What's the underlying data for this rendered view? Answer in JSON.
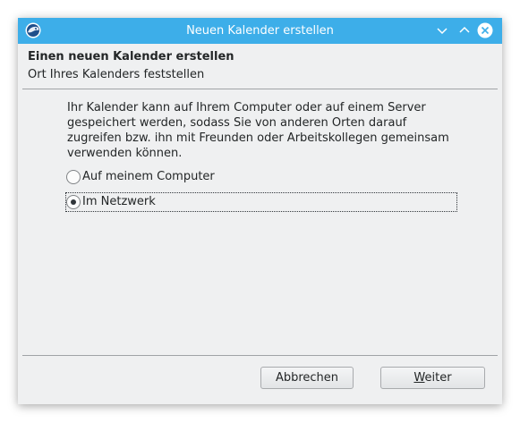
{
  "window": {
    "title": "Neuen Kalender erstellen",
    "app_icon": "thunderbird-icon",
    "accent": "#3daee9",
    "controls": {
      "minimize_icon": "chevron-down-icon",
      "maximize_icon": "chevron-up-icon",
      "close_icon": "close-circle-icon"
    }
  },
  "header": {
    "title": "Einen neuen Kalender erstellen",
    "subtitle": "Ort Ihres Kalenders feststellen"
  },
  "main": {
    "description": "Ihr Kalender kann auf Ihrem Computer oder auf einem Server gespeichert werden, sodass Sie von anderen Orten darauf zugreifen bzw. ihn mit Freunden oder Arbeitskollegen gemeinsam verwenden können.",
    "options": [
      {
        "label": "Auf meinem Computer",
        "selected": false
      },
      {
        "label": "Im Netzwerk",
        "selected": true
      }
    ]
  },
  "footer": {
    "cancel_label": "Abbrechen",
    "next_label_first": "W",
    "next_label_rest": "eiter"
  }
}
